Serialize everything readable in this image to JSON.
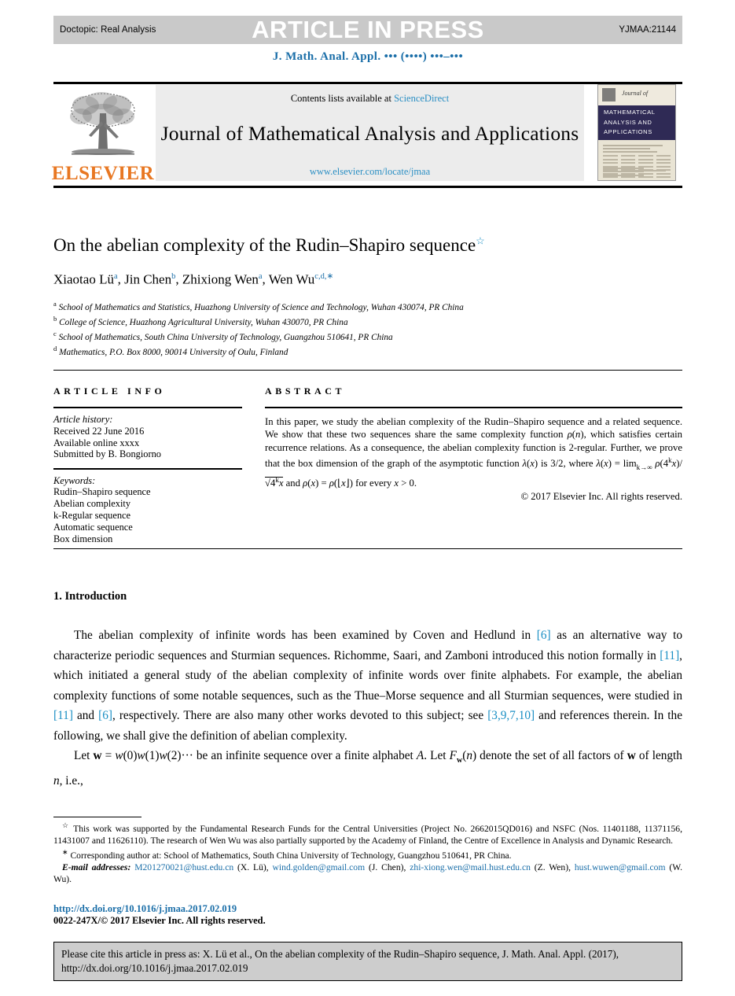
{
  "header": {
    "doctopic": "Doctopic: Real Analysis",
    "watermark": "ARTICLE IN PRESS",
    "article_code": "YJMAA:21144",
    "running_head": "J. Math. Anal. Appl. ••• (••••) •••–•••"
  },
  "masthead": {
    "contents_prefix": "Contents lists available at ",
    "contents_link": "ScienceDirect",
    "journal_title": "Journal of Mathematical Analysis and Applications",
    "journal_url": "www.elsevier.com/locate/jmaa",
    "publisher": "ELSEVIER",
    "cover": {
      "journal_of": "Journal of",
      "band_line1": "MATHEMATICAL",
      "band_line2": "ANALYSIS AND",
      "band_line3": "APPLICATIONS"
    }
  },
  "article": {
    "title": "On the abelian complexity of the Rudin–Shapiro sequence",
    "title_footnote_mark": "☆",
    "authors": [
      {
        "name": "Xiaotao Lü",
        "marks": "a"
      },
      {
        "name": "Jin Chen",
        "marks": "b"
      },
      {
        "name": "Zhixiong Wen",
        "marks": "a"
      },
      {
        "name": "Wen Wu",
        "marks": "c,d,∗"
      }
    ],
    "affiliations": [
      {
        "mark": "a",
        "text": "School of Mathematics and Statistics, Huazhong University of Science and Technology, Wuhan 430074, PR China"
      },
      {
        "mark": "b",
        "text": "College of Science, Huazhong Agricultural University, Wuhan 430070, PR China"
      },
      {
        "mark": "c",
        "text": "School of Mathematics, South China University of Technology, Guangzhou 510641, PR China"
      },
      {
        "mark": "d",
        "text": "Mathematics, P.O. Box 8000, 90014 University of Oulu, Finland"
      }
    ]
  },
  "info": {
    "heading": "ARTICLE INFO",
    "history_label": "Article history:",
    "history": [
      "Received 22 June 2016",
      "Available online xxxx",
      "Submitted by B. Bongiorno"
    ],
    "keywords_label": "Keywords:",
    "keywords": [
      "Rudin–Shapiro sequence",
      "Abelian complexity",
      "k-Regular sequence",
      "Automatic sequence",
      "Box dimension"
    ]
  },
  "abstract": {
    "heading": "ABSTRACT",
    "text": "In this paper, we study the abelian complexity of the Rudin–Shapiro sequence and a related sequence. We show that these two sequences share the same complexity function ρ(n), which satisfies certain recurrence relations. As a consequence, the abelian complexity function is 2-regular. Further, we prove that the box dimension of the graph of the asymptotic function λ(x) is 3/2, where λ(x) = lim k→∞ ρ(4ᵏx)/√(4ᵏx) and ρ(x) = ρ(⌊x⌋) for every x > 0.",
    "copyright": "© 2017 Elsevier Inc. All rights reserved."
  },
  "body": {
    "section_number_title": "1. Introduction",
    "para1_a": "The abelian complexity of infinite words has been examined by Coven and Hedlund in ",
    "para1_ref1": "[6]",
    "para1_b": " as an alternative way to characterize periodic sequences and Sturmian sequences. Richomme, Saari, and Zamboni introduced this notion formally in ",
    "para1_ref2": "[11]",
    "para1_c": ", which initiated a general study of the abelian complexity of infinite words over finite alphabets. For example, the abelian complexity functions of some notable sequences, such as the Thue–Morse sequence and all Sturmian sequences, were studied in ",
    "para1_ref3": "[11]",
    "para1_d": " and ",
    "para1_ref4": "[6]",
    "para1_e": ", respectively. There are also many other works devoted to this subject; see ",
    "para1_ref5": "[3,9,7,10]",
    "para1_f": " and references therein. In the following, we shall give the definition of abelian complexity.",
    "para2": "Let w = w(0)w(1)w(2)··· be an infinite sequence over a finite alphabet A. Let Fw(n) denote the set of all factors of w of length n, i.e.,"
  },
  "footnotes": {
    "funding_mark": "☆",
    "funding": "This work was supported by the Fundamental Research Funds for the Central Universities (Project No. 2662015QD016) and NSFC (Nos. 11401188, 11371156, 11431007 and 11626110). The research of Wen Wu was also partially supported by the Academy of Finland, the Centre of Excellence in Analysis and Dynamic Research.",
    "corresponding_mark": "∗",
    "corresponding": "Corresponding author at: School of Mathematics, South China University of Technology, Guangzhou 510641, PR China.",
    "email_label": "E-mail addresses:",
    "emails": [
      {
        "address": "M201270021@hust.edu.cn",
        "who": "(X. Lü)"
      },
      {
        "address": "wind.golden@gmail.com",
        "who": "(J. Chen)"
      },
      {
        "address": "zhi-xiong.wen@mail.hust.edu.cn",
        "who": "(Z. Wen)"
      },
      {
        "address": "hust.wuwen@gmail.com",
        "who": "(W. Wu)"
      }
    ],
    "doi": "http://dx.doi.org/10.1016/j.jmaa.2017.02.019",
    "issn": "0022-247X/© 2017 Elsevier Inc. All rights reserved."
  },
  "cite_box": {
    "text": "Please cite this article in press as: X. Lü et al., On the abelian complexity of the Rudin–Shapiro sequence, J. Math. Anal. Appl. (2017), http://dx.doi.org/10.1016/j.jmaa.2017.02.019"
  },
  "colors": {
    "link_blue": "#2b8fc4",
    "ref_blue": "#1a8fc4",
    "elsevier_orange": "#E87722",
    "press_bar_gray": "#c9c9c9",
    "mast_gray": "#ececec",
    "cite_gray": "#cdcdcd",
    "cover_band": "#2f2a55"
  }
}
